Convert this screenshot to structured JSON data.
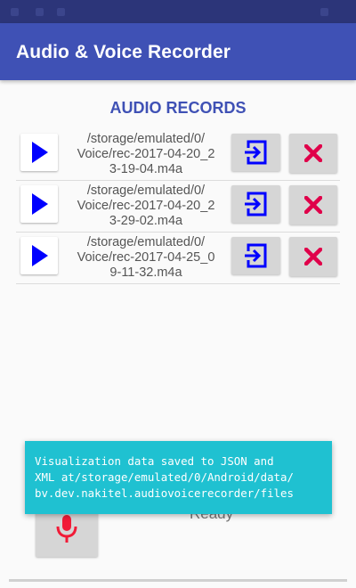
{
  "app_bar": {
    "title": "Audio & Voice Recorder"
  },
  "records_section": {
    "title": "AUDIO RECORDS"
  },
  "records": [
    {
      "path": "/storage/emulated/0/\nVoice/rec-2017-04-20_2\n3-19-04.m4a"
    },
    {
      "path": "/storage/emulated/0/\nVoice/rec-2017-04-20_2\n3-29-02.m4a"
    },
    {
      "path": "/storage/emulated/0/\nVoice/rec-2017-04-25_0\n9-11-32.m4a"
    }
  ],
  "status": {
    "text": "Ready"
  },
  "toast": {
    "message": "Visualization data saved to JSON and\nXML at/storage/emulated/0/Android/data/\nbv.dev.nakitel.audiovoicerecorder/files"
  },
  "icons": {
    "play": "play-icon",
    "share": "share-export-icon",
    "delete": "close-x-icon",
    "mic": "microphone-icon"
  },
  "colors": {
    "primary": "#3f51b5",
    "primary_dark": "#2c3579",
    "play": "#0000ff",
    "share": "#0000ff",
    "delete": "#e0004a",
    "mic": "#f11b37",
    "toast": "#1fc1d1"
  }
}
